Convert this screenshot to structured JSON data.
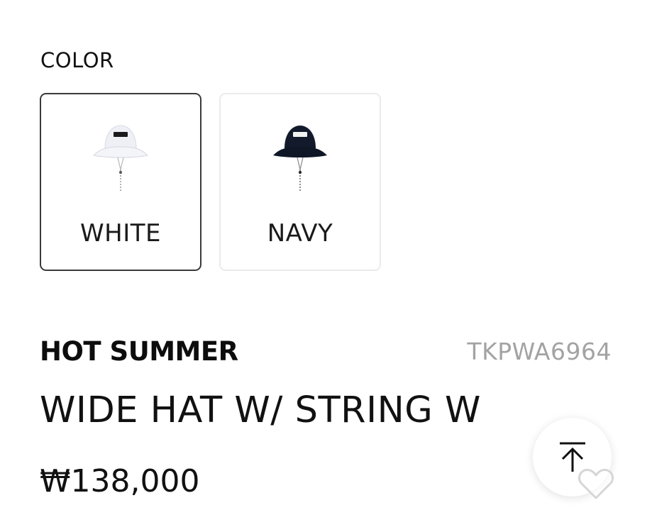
{
  "color_section": {
    "label": "COLOR",
    "options": [
      {
        "name": "WHITE",
        "selected": true,
        "hat_color": "#f2f3f7"
      },
      {
        "name": "NAVY",
        "selected": false,
        "hat_color": "#121a2b"
      }
    ]
  },
  "product": {
    "brand": "HOT SUMMER",
    "sku": "TKPWA6964",
    "title": "WIDE HAT W/ STRING W",
    "price": "₩138,000"
  },
  "icons": {
    "scroll_top": "arrow-up-to-line-icon",
    "wishlist": "heart-outline-icon"
  }
}
